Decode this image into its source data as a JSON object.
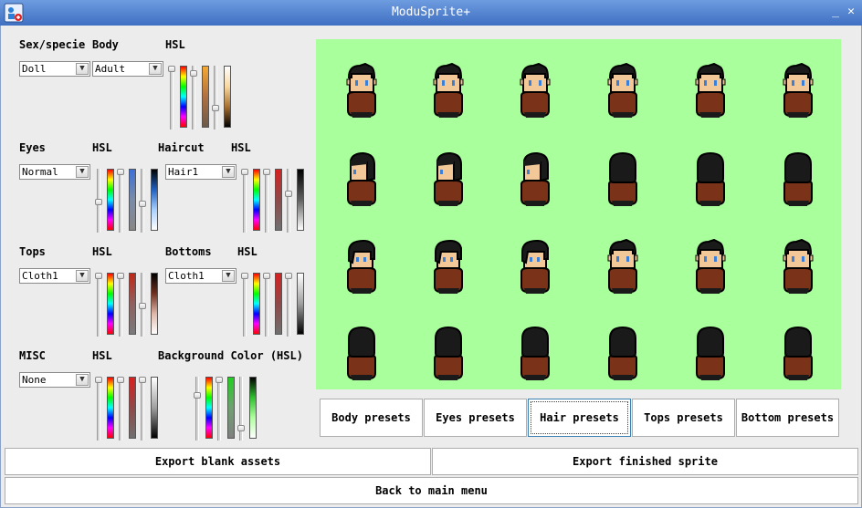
{
  "window": {
    "title": "ModuSprite+",
    "minimize_glyph": "_",
    "close_glyph": "✕"
  },
  "body_section": {
    "species_label": "Sex/specie",
    "species_value": "Doll",
    "body_label": "Body",
    "body_value": "Adult",
    "hsl_label": "HSL"
  },
  "eyes_section": {
    "label": "Eyes",
    "value": "Normal",
    "hsl_label": "HSL"
  },
  "haircut_section": {
    "label": "Haircut",
    "value": "Hair1",
    "hsl_label": "HSL"
  },
  "tops_section": {
    "label": "Tops",
    "value": "Cloth1",
    "hsl_label": "HSL"
  },
  "bottoms_section": {
    "label": "Bottoms",
    "value": "Cloth1",
    "hsl_label": "HSL"
  },
  "misc_section": {
    "label": "MISC",
    "value": "None",
    "hsl_label": "HSL"
  },
  "background_section": {
    "label": "Background Color (HSL)",
    "color": "#aaff9d"
  },
  "sprite_sheet": {
    "rows": [
      [
        "front",
        "front",
        "front",
        "front",
        "front",
        "front"
      ],
      [
        "side",
        "side",
        "side",
        "back",
        "back",
        "back"
      ],
      [
        "side-front",
        "side-front",
        "side-front",
        "front",
        "front",
        "front"
      ],
      [
        "back",
        "back",
        "back",
        "back",
        "back",
        "back"
      ]
    ],
    "colors": {
      "hair": "#1a1a1a",
      "skin": "#f3c899",
      "shirt": "#7a3218",
      "eyes": "#3a7fd8",
      "outline": "#000000"
    }
  },
  "presets": {
    "buttons": [
      "Body presets",
      "Eyes presets",
      "Hair presets",
      "Tops presets",
      "Bottom presets"
    ],
    "selected": "Hair presets"
  },
  "actions": {
    "export_blank": "Export blank assets",
    "export_finished": "Export finished sprite",
    "back": "Back to main menu"
  }
}
